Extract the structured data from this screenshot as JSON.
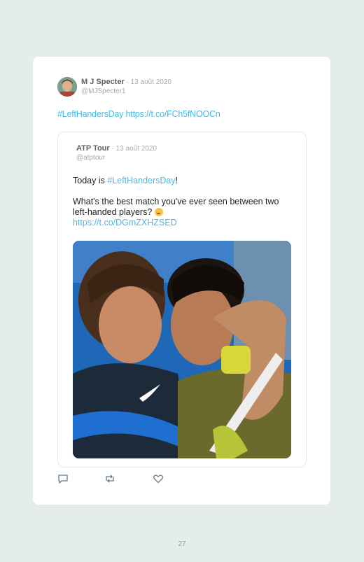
{
  "author": {
    "name": "M J Specter",
    "date": " · 13 août 2020",
    "handle": "@MJSpecter1"
  },
  "tweet": {
    "text": "#LeftHandersDay https://t.co/FCh5fNOOCn"
  },
  "quoted": {
    "name": "ATP Tour",
    "date": " · 13 août 2020",
    "handle": "@atptour",
    "line1_prefix": "Today is ",
    "hashtag": "#LeftHandersDay",
    "line1_suffix": "!",
    "question": "What's the best match you've ever seen between two left-handed players? ",
    "emoji": "thinking-face-emoji",
    "link": "https://t.co/DGmZXHZSED"
  },
  "actions": {
    "reply_icon": "reply-icon",
    "retweet_icon": "retweet-icon",
    "like_icon": "heart-icon"
  },
  "page_number": "27",
  "colors": {
    "background": "#e5ecec",
    "link": "#48b9e6",
    "muted": "#a4abb1"
  }
}
